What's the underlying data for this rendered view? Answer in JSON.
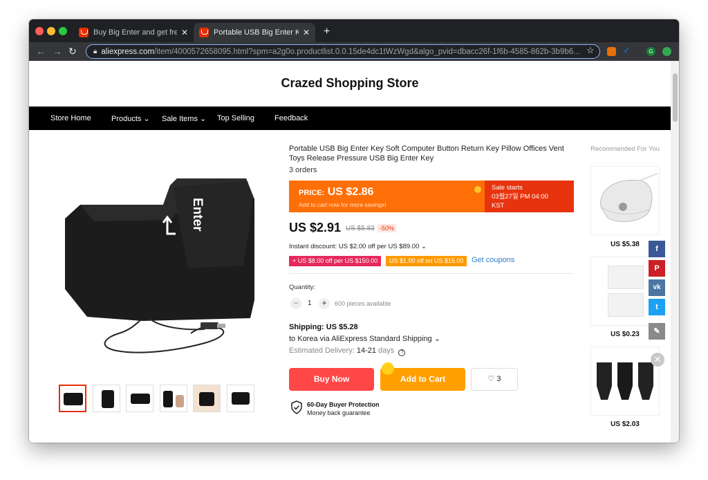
{
  "browser": {
    "tabs": [
      {
        "label": "Buy Big Enter and get free ship",
        "close": "✕"
      },
      {
        "label": "Portable USB Big Enter Key Sof",
        "close": "✕"
      }
    ],
    "new_tab": "+",
    "url_host": "aliexpress.com",
    "url_path": "/item/4000572658095.html?spm=a2g0o.productlist.0.0.15de4dc1tWzWgd&algo_pvid=dbacc26f-1f6b-4585-862b-3b9b6...",
    "profile_letter": "G"
  },
  "store": {
    "title": "Crazed Shopping Store",
    "nav": [
      "Store Home",
      "Products",
      "Sale Items",
      "Top Selling",
      "Feedback"
    ]
  },
  "product": {
    "title": "Portable USB Big Enter Key Soft Computer Button Return Key Pillow Offices Vent Toys Release Pressure USB Big Enter Key",
    "orders": "3 orders",
    "promo": {
      "price_label": "PRICE:",
      "price": "US $2.86",
      "sub": "Add to cart now for more savings!",
      "sale_title": "Sale starts",
      "sale_time": "03월27일 PM 04:00",
      "sale_tz": "KST"
    },
    "price": "US $2.91",
    "old_price": "US $5.83",
    "discount": "-50%",
    "instant_discount": "Instant discount: US $2.00 off per US $89.00 ⌄",
    "coupons": [
      "+ US $8.00 off per US $150.00",
      "US $1.00 off on US $15.00"
    ],
    "get_coupons": "Get coupons",
    "quantity_label": "Quantity:",
    "quantity": "1",
    "available": "600 pieces available",
    "shipping": "Shipping: US $5.28",
    "ship_to": "to Korea via AliExpress Standard Shipping ⌄",
    "delivery_label": "Estimated Delivery:",
    "delivery_value": "14-21",
    "delivery_unit": "days",
    "buy_now": "Buy Now",
    "add_to_cart": "Add to Cart",
    "wishlist_count": "3",
    "protection_title": "60-Day Buyer Protection",
    "protection_sub": "Money back guarantee",
    "enter_key_label": "Enter"
  },
  "recommended": {
    "title": "Recommended For You",
    "items": [
      {
        "price": "US $5.38"
      },
      {
        "price": "US $0.23"
      },
      {
        "price": "US $2.03"
      }
    ]
  },
  "social": [
    "f",
    "P",
    "vk",
    "t",
    "✎"
  ],
  "colors": {
    "accent_red": "#ff4747",
    "accent_orange": "#ff9f00",
    "promo_orange": "#ff6f07",
    "link_blue": "#2e7cc9"
  }
}
